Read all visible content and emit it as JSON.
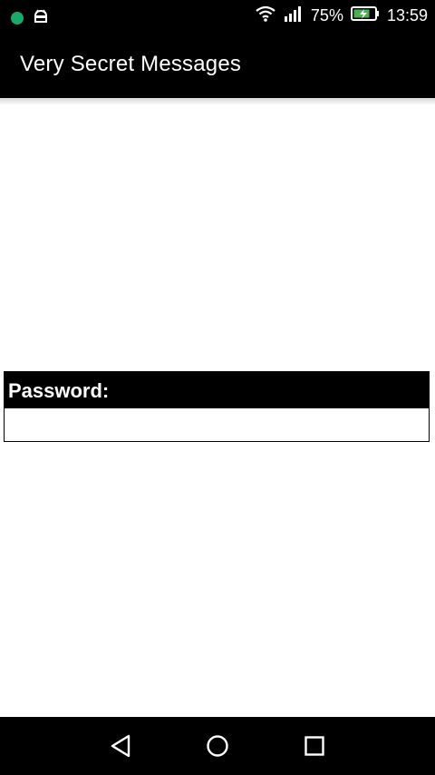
{
  "status_bar": {
    "battery_percent": "75%",
    "time": "13:59",
    "icons": [
      "notification-dot-icon",
      "android-icon",
      "wifi-icon",
      "signal-icon",
      "battery-charging-icon"
    ]
  },
  "app_bar": {
    "title": "Very Secret Messages"
  },
  "password_form": {
    "label": "Password:",
    "value": ""
  },
  "nav_bar": {
    "buttons": [
      "back",
      "home",
      "recents"
    ]
  },
  "colors": {
    "bars": "#000000",
    "background": "#ffffff",
    "notification_dot": "#1aa86b",
    "battery_fill": "#4caf50"
  }
}
